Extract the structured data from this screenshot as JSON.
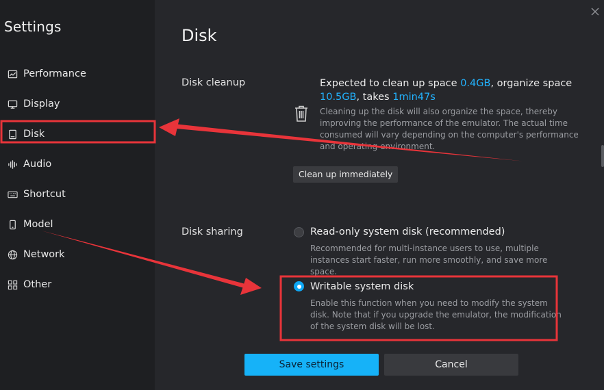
{
  "sidebar": {
    "title": "Settings",
    "items": [
      {
        "label": "Performance",
        "icon": "performance-chart-icon"
      },
      {
        "label": "Display",
        "icon": "monitor-icon"
      },
      {
        "label": "Disk",
        "icon": "disk-icon"
      },
      {
        "label": "Audio",
        "icon": "audio-wave-icon"
      },
      {
        "label": "Shortcut",
        "icon": "keyboard-icon"
      },
      {
        "label": "Model",
        "icon": "phone-icon"
      },
      {
        "label": "Network",
        "icon": "globe-icon"
      },
      {
        "label": "Other",
        "icon": "grid-icon"
      }
    ],
    "selected": "Disk"
  },
  "main": {
    "title": "Disk",
    "cleanup": {
      "label": "Disk cleanup",
      "summary_prefix": "Expected to clean up space ",
      "clean_space": "0.4GB",
      "summary_mid": ", organize space ",
      "organize_space": "10.5GB",
      "summary_takes": ", takes ",
      "time": "1min47s",
      "description": "Cleaning up the disk will also organize the space, thereby improving the performance of the emulator. The actual time consumed will vary depending on the computer's performance and operating environment.",
      "button_label": "Clean up immediately"
    },
    "sharing": {
      "label": "Disk sharing",
      "options": [
        {
          "label": "Read-only system disk (recommended)",
          "description": "Recommended for multi-instance users to use, multiple instances start faster, run more smoothly, and save more space.",
          "selected": false
        },
        {
          "label": "Writable system disk",
          "description": "Enable this function when you need to modify the system disk. Note that if you upgrade the emulator, the modification of the system disk will be lost.",
          "selected": true
        }
      ]
    }
  },
  "footer": {
    "save_label": "Save settings",
    "cancel_label": "Cancel"
  },
  "colors": {
    "accent": "#16b2f8",
    "annotation": "#e8343a",
    "sidebar_bg": "#1e1f22",
    "main_bg": "#26272b"
  }
}
